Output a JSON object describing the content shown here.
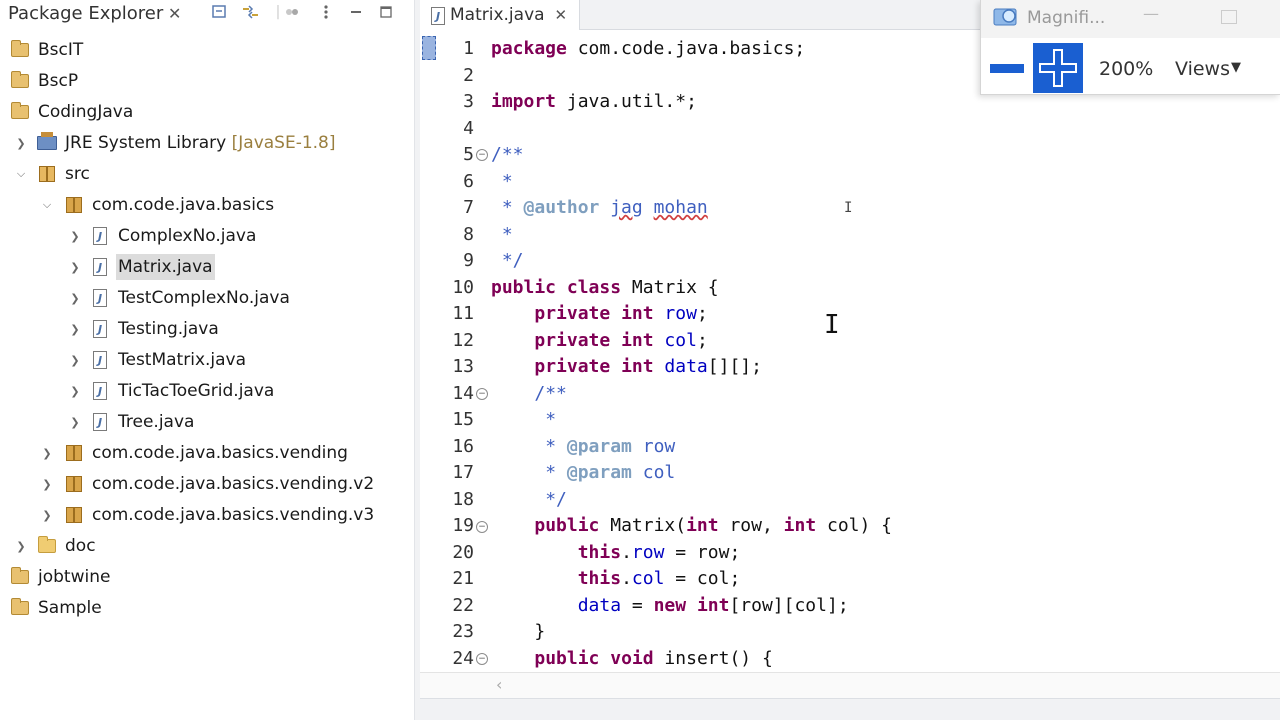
{
  "explorer": {
    "title": "Package Explorer",
    "close": "✕",
    "nodes": [
      {
        "label": "BscIT",
        "icon": "project-icon"
      },
      {
        "label": "BscP",
        "icon": "project-icon"
      },
      {
        "label": "CodingJava",
        "icon": "project-icon"
      },
      {
        "label": "JRE System Library",
        "decoration": "[JavaSE-1.8]",
        "icon": "library-icon",
        "twisty": "collapsed"
      },
      {
        "label": "src",
        "icon": "source-folder-icon",
        "twisty": "expanded"
      },
      {
        "label": "com.code.java.basics",
        "icon": "package-icon",
        "twisty": "expanded"
      },
      {
        "label": "ComplexNo.java",
        "icon": "java-file-icon",
        "twisty": "collapsed"
      },
      {
        "label": "Matrix.java",
        "icon": "java-file-icon",
        "twisty": "collapsed",
        "selected": true
      },
      {
        "label": "TestComplexNo.java",
        "icon": "java-file-icon",
        "twisty": "collapsed"
      },
      {
        "label": "Testing.java",
        "icon": "java-file-icon",
        "twisty": "collapsed"
      },
      {
        "label": "TestMatrix.java",
        "icon": "java-file-icon",
        "twisty": "collapsed"
      },
      {
        "label": "TicTacToeGrid.java",
        "icon": "java-file-icon",
        "twisty": "collapsed"
      },
      {
        "label": "Tree.java",
        "icon": "java-file-icon",
        "twisty": "collapsed"
      },
      {
        "label": "com.code.java.basics.vending",
        "icon": "package-icon",
        "twisty": "collapsed"
      },
      {
        "label": "com.code.java.basics.vending.v2",
        "icon": "package-icon",
        "twisty": "collapsed"
      },
      {
        "label": "com.code.java.basics.vending.v3",
        "icon": "package-icon",
        "twisty": "collapsed"
      },
      {
        "label": "doc",
        "icon": "folder-icon",
        "twisty": "collapsed"
      },
      {
        "label": "jobtwine",
        "icon": "project-icon"
      },
      {
        "label": "Sample",
        "icon": "project-icon"
      }
    ]
  },
  "editor": {
    "tab": {
      "label": "Matrix.java",
      "close": "✕"
    },
    "line_numbers": [
      "1",
      "2",
      "3",
      "4",
      "5",
      "6",
      "7",
      "8",
      "9",
      "10",
      "11",
      "12",
      "13",
      "14",
      "15",
      "16",
      "17",
      "18",
      "19",
      "20",
      "21",
      "22",
      "23",
      "24"
    ],
    "folds": [
      "5",
      "14",
      "19",
      "24"
    ],
    "lines": {
      "l1": {
        "kw": "package",
        "rest": " com.code.java.basics;"
      },
      "l3": {
        "kw": "import",
        "rest": " java.util.*;"
      },
      "l5": "/**",
      "l6": " *",
      "l7": {
        "star": " * ",
        "tag": "@author",
        "space": " ",
        "name1": "jag",
        "space2": " ",
        "name2": "mohan"
      },
      "l8": " *",
      "l9": " */",
      "l10": {
        "kw1": "public",
        "kw2": "class",
        "rest": " Matrix {"
      },
      "l11": {
        "kw1": "private",
        "kw2": "int",
        "field": "row",
        "end": ";"
      },
      "l12": {
        "kw1": "private",
        "kw2": "int",
        "field": "col",
        "end": ";"
      },
      "l13": {
        "kw1": "private",
        "kw2": "int",
        "field": "data",
        "end": "[][];"
      },
      "l14": "/**",
      "l15": " *",
      "l16": {
        "star": " * ",
        "tag": "@param",
        "param": " row"
      },
      "l17": {
        "star": " * ",
        "tag": "@param",
        "param": " col"
      },
      "l18": " */",
      "l19": {
        "kw1": "public",
        "mid1": " Matrix(",
        "kw2": "int",
        "mid2": " row, ",
        "kw3": "int",
        "end": " col) {"
      },
      "l20": {
        "kw": "this",
        "dot": ".",
        "field": "row",
        "end": " = row;"
      },
      "l21": {
        "kw": "this",
        "dot": ".",
        "field": "col",
        "end": " = col;"
      },
      "l22": {
        "field": "data",
        "mid": " = ",
        "kw1": "new",
        "sp": " ",
        "kw2": "int",
        "end": "[row][col];"
      },
      "l23": "}",
      "l24": {
        "kw1": "public",
        "kw2": "void",
        "end": " insert() {"
      }
    }
  },
  "magnifier": {
    "title": "Magnifi...",
    "zoom_level": "200%",
    "views_label": "Views",
    "minimize": "—",
    "colors": {
      "accent": "#1a5fd1"
    }
  },
  "colors": {
    "keyword": "#7f0055",
    "comment": "#3f5fbf",
    "javadoc_tag": "#7f9fbf",
    "field": "#0000c0"
  }
}
